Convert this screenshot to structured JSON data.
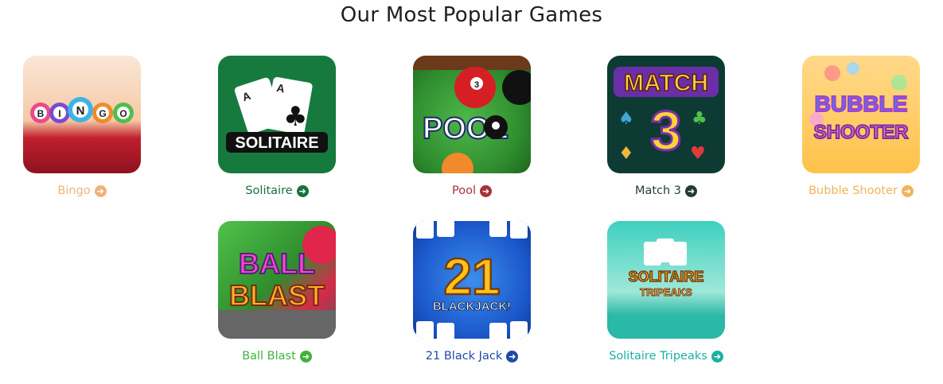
{
  "section": {
    "title": "Our Most Popular Games"
  },
  "games": [
    {
      "name": "Bingo",
      "color": "#f0b27a",
      "icon": "bingo-icon",
      "tile_text": "BINGO"
    },
    {
      "name": "Solitaire",
      "color": "#14733e",
      "icon": "solitaire-icon",
      "tile_text": "SOLITAIRE"
    },
    {
      "name": "Pool",
      "color": "#a6323a",
      "icon": "pool-icon",
      "tile_text": "POOL"
    },
    {
      "name": "Match 3",
      "color": "#1f3c3a",
      "icon": "match3-icon",
      "tile_text": "MATCH 3"
    },
    {
      "name": "Bubble Shooter",
      "color": "#f0b45a",
      "icon": "bubble-shooter-icon",
      "tile_text": "BUBBLE SHOOTER"
    },
    {
      "name": "Ball Blast",
      "color": "#3fb23a",
      "icon": "ball-blast-icon",
      "tile_text": "BALL BLAST"
    },
    {
      "name": "21 Black Jack",
      "color": "#1f4aa8",
      "icon": "blackjack-icon",
      "tile_text": "21 BLACKJACK!"
    },
    {
      "name": "Solitaire Tripeaks",
      "color": "#1bb0a3",
      "icon": "solitaire-tripeaks-icon",
      "tile_text": "SOLITAIRE TRIPEAKS"
    }
  ]
}
